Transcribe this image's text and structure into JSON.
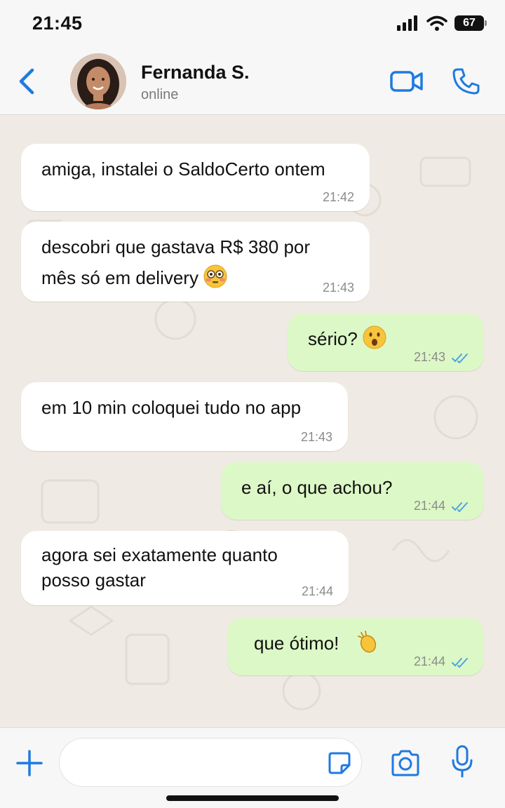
{
  "status_bar": {
    "time": "21:45",
    "battery": "67"
  },
  "header": {
    "contact_name": "Fernanda S.",
    "contact_status": "online",
    "icons": {
      "back": "chevron-left-icon",
      "video": "video-camera-icon",
      "call": "phone-icon"
    }
  },
  "messages": [
    {
      "direction": "in",
      "text": [
        "amiga, instalei o SaldoCerto ontem"
      ],
      "time": "21:42"
    },
    {
      "direction": "in",
      "text": [
        "descobri que gastava R$ 380 por",
        "mês só em delivery"
      ],
      "emoji": "flushed-face",
      "time": "21:43"
    },
    {
      "direction": "out",
      "text": [
        "sério?"
      ],
      "emoji": "hushed-face",
      "time": "21:43",
      "status": "read"
    },
    {
      "direction": "in",
      "text": [
        "em 10 min coloquei tudo no app"
      ],
      "time": "21:43"
    },
    {
      "direction": "out",
      "text": [
        "e aí, o que achou?"
      ],
      "time": "21:44",
      "status": "read"
    },
    {
      "direction": "in",
      "text": [
        "agora sei exatamente quanto",
        "posso gastar"
      ],
      "time": "21:44"
    },
    {
      "direction": "out",
      "text": [
        "que ótimo!"
      ],
      "emoji": "clapping-hands",
      "time": "21:44",
      "status": "read"
    }
  ],
  "composer": {
    "input_value": "",
    "icons": {
      "plus": "plus-icon",
      "sticker": "sticker-icon",
      "camera": "camera-icon",
      "mic": "microphone-icon"
    }
  },
  "colors": {
    "accent": "#1f7ae0",
    "incoming_bubble": "#ffffff",
    "outgoing_bubble": "#dcf8c6",
    "chat_background": "#efebe4",
    "read_ticks": "#4fa3e0"
  }
}
